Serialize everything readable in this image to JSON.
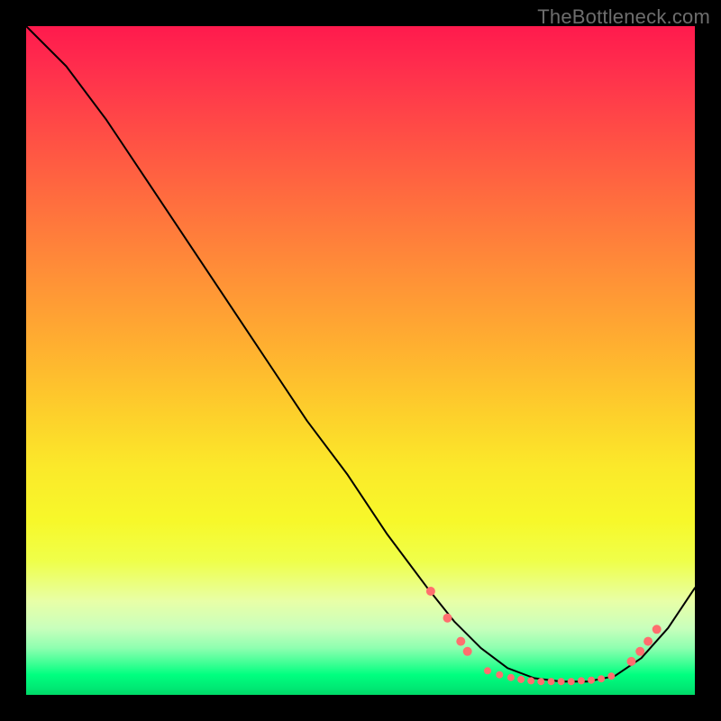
{
  "watermark": "TheBottleneck.com",
  "chart_data": {
    "type": "line",
    "title": "",
    "xlabel": "",
    "ylabel": "",
    "xlim": [
      0,
      100
    ],
    "ylim": [
      0,
      100
    ],
    "grid": false,
    "series": [
      {
        "name": "curve",
        "x": [
          0,
          6,
          12,
          18,
          24,
          30,
          36,
          42,
          48,
          54,
          60,
          64,
          68,
          72,
          76,
          80,
          84,
          88,
          92,
          96,
          100
        ],
        "y": [
          100,
          94,
          86,
          77,
          68,
          59,
          50,
          41,
          33,
          24,
          16,
          11,
          7,
          4,
          2.5,
          2,
          2,
          2.8,
          5.5,
          10,
          16
        ],
        "stroke": "#000000",
        "stroke_width": 2
      }
    ],
    "markers": [
      {
        "x": 60.5,
        "y": 15.5,
        "r": 5,
        "fill": "#ff6e6e"
      },
      {
        "x": 63.0,
        "y": 11.5,
        "r": 5,
        "fill": "#ff6e6e"
      },
      {
        "x": 65.0,
        "y": 8.0,
        "r": 5,
        "fill": "#ff6e6e"
      },
      {
        "x": 66.0,
        "y": 6.5,
        "r": 5,
        "fill": "#ff6e6e"
      },
      {
        "x": 69.0,
        "y": 3.6,
        "r": 4,
        "fill": "#ff6e6e"
      },
      {
        "x": 70.8,
        "y": 3.0,
        "r": 4,
        "fill": "#ff6e6e"
      },
      {
        "x": 72.5,
        "y": 2.6,
        "r": 4,
        "fill": "#ff6e6e"
      },
      {
        "x": 74.0,
        "y": 2.3,
        "r": 4,
        "fill": "#ff6e6e"
      },
      {
        "x": 75.5,
        "y": 2.1,
        "r": 4,
        "fill": "#ff6e6e"
      },
      {
        "x": 77.0,
        "y": 2.0,
        "r": 4,
        "fill": "#ff6e6e"
      },
      {
        "x": 78.5,
        "y": 2.0,
        "r": 4,
        "fill": "#ff6e6e"
      },
      {
        "x": 80.0,
        "y": 2.0,
        "r": 4,
        "fill": "#ff6e6e"
      },
      {
        "x": 81.5,
        "y": 2.0,
        "r": 4,
        "fill": "#ff6e6e"
      },
      {
        "x": 83.0,
        "y": 2.1,
        "r": 4,
        "fill": "#ff6e6e"
      },
      {
        "x": 84.5,
        "y": 2.2,
        "r": 4,
        "fill": "#ff6e6e"
      },
      {
        "x": 86.0,
        "y": 2.4,
        "r": 4,
        "fill": "#ff6e6e"
      },
      {
        "x": 87.5,
        "y": 2.8,
        "r": 4,
        "fill": "#ff6e6e"
      },
      {
        "x": 90.5,
        "y": 5.0,
        "r": 5,
        "fill": "#ff6e6e"
      },
      {
        "x": 91.8,
        "y": 6.5,
        "r": 5,
        "fill": "#ff6e6e"
      },
      {
        "x": 93.0,
        "y": 8.0,
        "r": 5,
        "fill": "#ff6e6e"
      },
      {
        "x": 94.3,
        "y": 9.8,
        "r": 5,
        "fill": "#ff6e6e"
      }
    ],
    "gradient_stops": [
      {
        "pos": 0.0,
        "color": "#ff1a4d"
      },
      {
        "pos": 0.25,
        "color": "#ff6a3f"
      },
      {
        "pos": 0.58,
        "color": "#fdd02b"
      },
      {
        "pos": 0.8,
        "color": "#efff4a"
      },
      {
        "pos": 0.95,
        "color": "#37ff92"
      },
      {
        "pos": 1.0,
        "color": "#00d968"
      }
    ]
  }
}
